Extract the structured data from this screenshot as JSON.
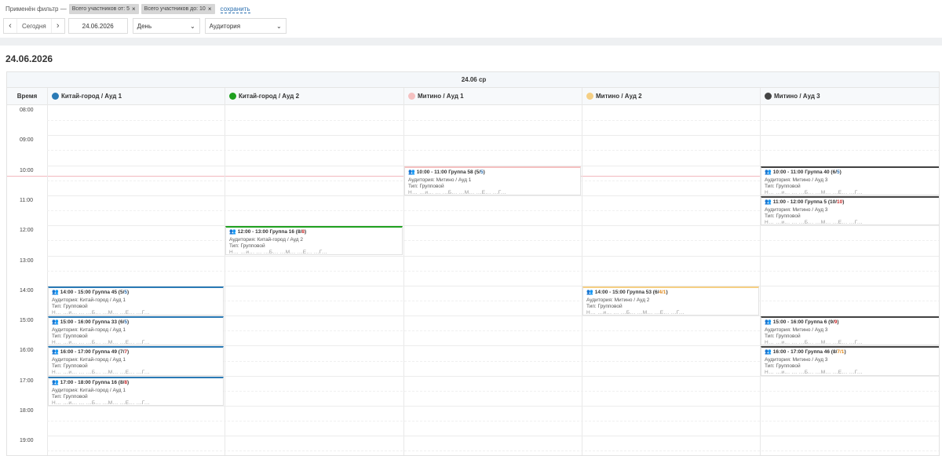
{
  "filter": {
    "label": "Применён фильтр —",
    "chips": [
      "Всего участников от: 5",
      "Всего участников до: 10"
    ],
    "save": "сохранить"
  },
  "controls": {
    "prev": "‹",
    "today": "Сегодня",
    "next": "›",
    "date": "24.06.2026",
    "view": "День",
    "group": "Аудитория"
  },
  "date_title": "24.06.2026",
  "calendar": {
    "day_header": "24.06 ср",
    "time_label": "Время",
    "hours": [
      "08:00",
      "09:00",
      "10:00",
      "11:00",
      "12:00",
      "13:00",
      "14:00",
      "15:00",
      "16:00",
      "17:00",
      "18:00",
      "19:00"
    ],
    "resources": [
      {
        "name": "Китай-город / Ауд 1",
        "color": "#2a7ab5"
      },
      {
        "name": "Китай-город / Ауд 2",
        "color": "#1fa01f"
      },
      {
        "name": "Митино / Ауд 1",
        "color": "#f5c1c1"
      },
      {
        "name": "Митино / Ауд 2",
        "color": "#f5cf84"
      },
      {
        "name": "Митино / Ауд 3",
        "color": "#444444"
      }
    ],
    "events": [
      {
        "res": 2,
        "start": 10,
        "time": "10:00 - 11:00 Группа 58",
        "count": "5",
        "cnt_a": "",
        "cnt_b": "5",
        "room": "Аудитория: Митино / Ауд 1",
        "type": "Тип: Групповой",
        "extra": "Н... ...и... ... ...Б... ...М... ...Е... ...Г...",
        "color": "#f5c1c1"
      },
      {
        "res": 4,
        "start": 10,
        "time": "10:00 - 11:00 Группа 40",
        "count": "6",
        "cnt_a": "",
        "cnt_b": "5",
        "room": "Аудитория: Митино / Ауд 3",
        "type": "Тип: Групповой",
        "extra": "Н... ...и... ... ...Б... ...М... ...Е... ...Г...",
        "color": "#444444"
      },
      {
        "res": 4,
        "start": 11,
        "time": "11:00 - 12:00 Группа 5",
        "count": "10",
        "cnt_a": "10",
        "cnt_b": "",
        "room": "Аудитория: Митино / Ауд 3",
        "type": "Тип: Групповой",
        "extra": "Н... ...и... ... ...Б... ...М... ...Е... ...Г...",
        "color": "#444444"
      },
      {
        "res": 1,
        "start": 12,
        "time": "12:00 - 13:00 Группа 16",
        "count": "8",
        "cnt_a": "8",
        "cnt_b": "",
        "room": "Аудитория: Китай-город / Ауд 2",
        "type": "Тип: Групповой",
        "extra": "Н... ...и... ... ...Б... ...М... ...Е... ...Г...",
        "color": "#1fa01f"
      },
      {
        "res": 0,
        "start": 14,
        "time": "14:00 - 15:00 Группа 45",
        "count": "5",
        "cnt_a": "",
        "cnt_b": "5",
        "room": "Аудитория: Китай-город / Ауд 1",
        "type": "Тип: Групповой",
        "extra": "Н... ...и... ... ...Б... ...М... ...Е... ...Г...",
        "color": "#2a7ab5"
      },
      {
        "res": 3,
        "start": 14,
        "time": "14:00 - 15:00 Группа 53",
        "count": "6",
        "cnt_a": "",
        "cnt_b": "",
        "cnt_c": "4/1",
        "room": "Аудитория: Митино / Ауд 2",
        "type": "Тип: Групповой",
        "extra": "Н... ...и... ... ...Б... ...М... ...Е... ...Г...",
        "color": "#f5cf84"
      },
      {
        "res": 0,
        "start": 15,
        "time": "15:00 - 16:00 Группа 33",
        "count": "6",
        "cnt_a": "",
        "cnt_b": "5",
        "room": "Аудитория: Китай-город / Ауд 1",
        "type": "Тип: Групповой",
        "extra": "Н... ...и... ... ...Б... ...М... ...Е... ...Г...",
        "color": "#2a7ab5"
      },
      {
        "res": 4,
        "start": 15,
        "time": "15:00 - 16:00 Группа 6",
        "count": "9",
        "cnt_a": "9",
        "cnt_b": "",
        "room": "Аудитория: Митино / Ауд 3",
        "type": "Тип: Групповой",
        "extra": "Н... ...и... ... ...Б... ...М... ...Е... ...Г...",
        "color": "#444444"
      },
      {
        "res": 0,
        "start": 16,
        "time": "16:00 - 17:00 Группа 49",
        "count": "7",
        "cnt_a": "7",
        "cnt_b": "",
        "room": "Аудитория: Китай-город / Ауд 1",
        "type": "Тип: Групповой",
        "extra": "Н... ...и... ... ...Б... ...М... ...Е... ...Г...",
        "color": "#2a7ab5"
      },
      {
        "res": 4,
        "start": 16,
        "time": "16:00 - 17:00 Группа 46",
        "count": "8",
        "cnt_a": "",
        "cnt_b": "",
        "cnt_c": "7/1",
        "room": "Аудитория: Митино / Ауд 3",
        "type": "Тип: Групповой",
        "extra": "Н... ...и... ... ...Б... ...М... ...Е... ...Г...",
        "color": "#444444"
      },
      {
        "res": 0,
        "start": 17,
        "time": "17:00 - 18:00 Группа 16",
        "count": "8",
        "cnt_a": "8",
        "cnt_b": "",
        "room": "Аудитория: Китай-город / Ауд 1",
        "type": "Тип: Групповой",
        "extra": "Н... ...и... ... ...Б... ...М... ...Е... ...Г...",
        "color": "#2a7ab5"
      }
    ]
  }
}
